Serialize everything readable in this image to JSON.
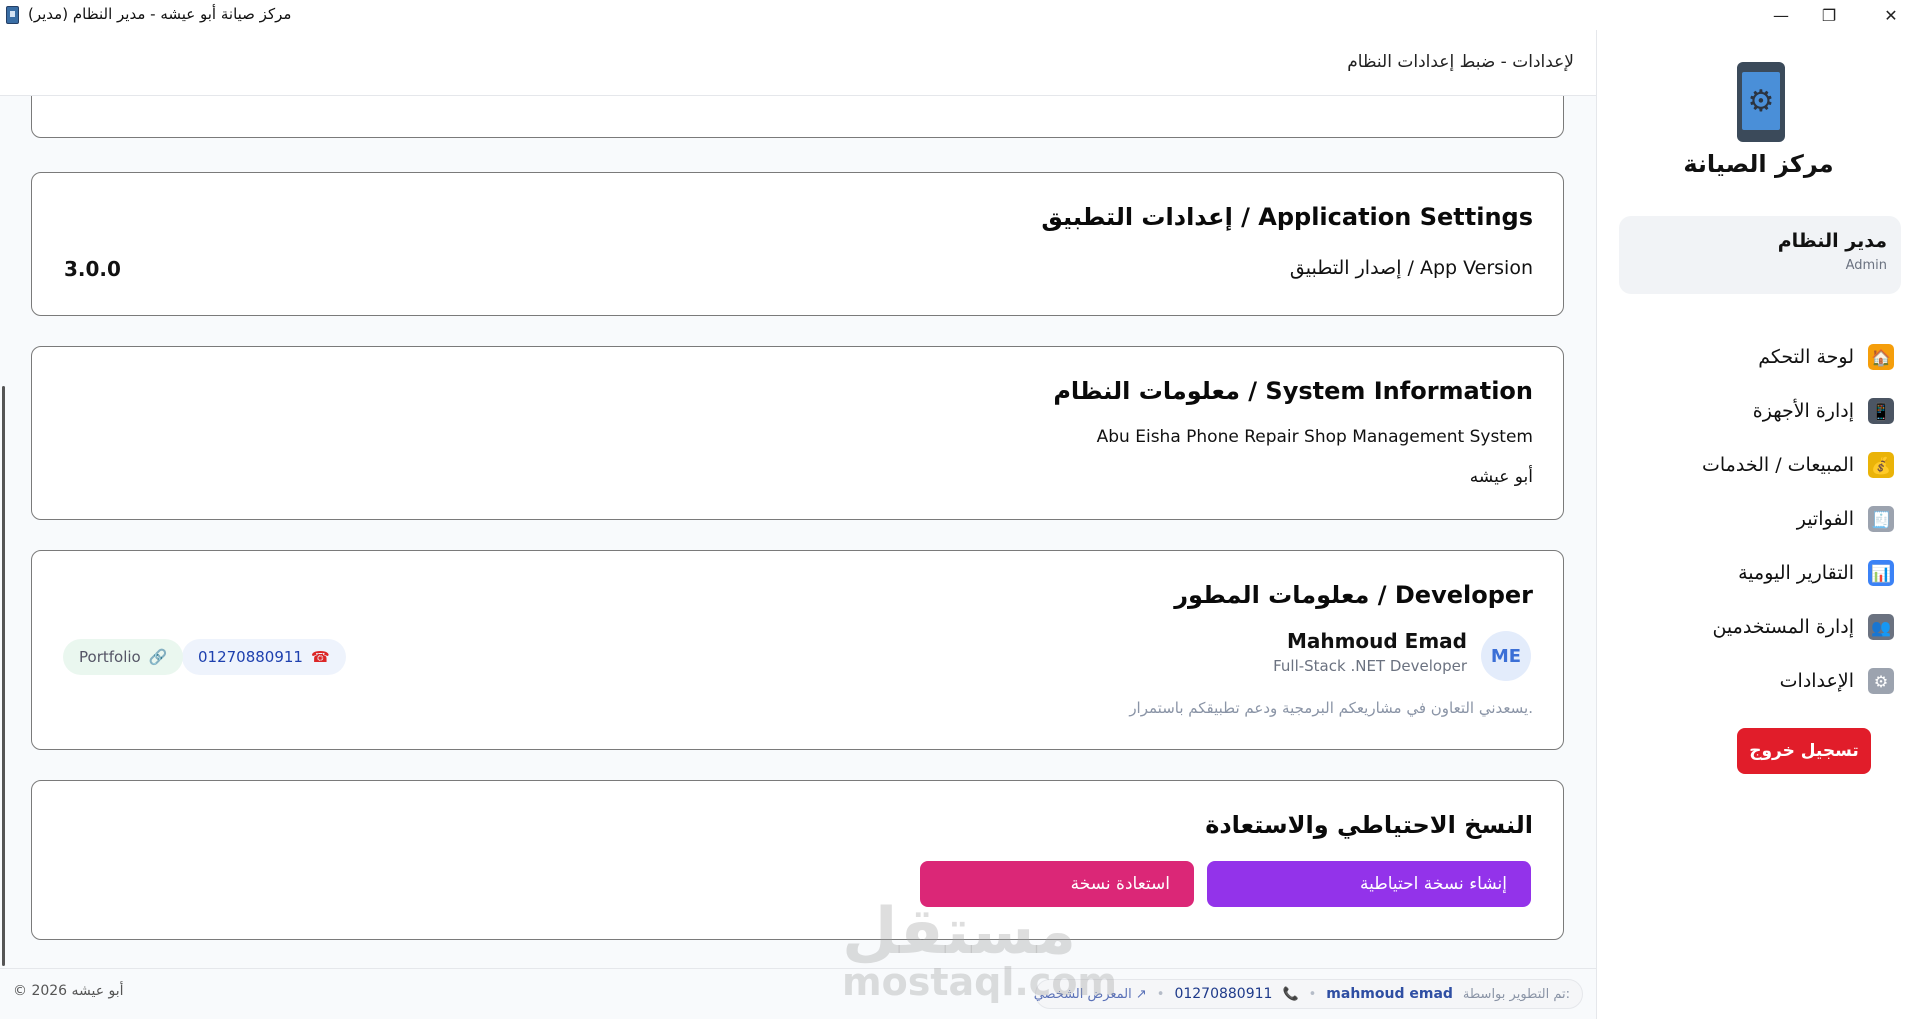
{
  "window": {
    "title": "مركز صيانة أبو عيشه - مدير النظام (مدير)",
    "minimize": "—",
    "maximize": "❐",
    "close": "✕"
  },
  "sidebar": {
    "brand": "مركز الصيانة",
    "user": {
      "name": "مدير النظام",
      "role": "Admin"
    },
    "items": [
      {
        "label": "لوحة التحكم",
        "icon": "home-icon",
        "glyph": "🏠",
        "color": "#f59e0b"
      },
      {
        "label": "إدارة الأجهزة",
        "icon": "device-icon",
        "glyph": "📱",
        "color": "#4b5563"
      },
      {
        "label": "المبيعات / الخدمات",
        "icon": "money-bag-icon",
        "glyph": "💰",
        "color": "#eab308"
      },
      {
        "label": "الفواتير",
        "icon": "invoice-icon",
        "glyph": "🧾",
        "color": "#9ca3af"
      },
      {
        "label": "التقارير اليومية",
        "icon": "chart-icon",
        "glyph": "📊",
        "color": "#3b82f6"
      },
      {
        "label": "إدارة المستخدمين",
        "icon": "users-icon",
        "glyph": "👥",
        "color": "#6b7280"
      },
      {
        "label": "الإعدادات",
        "icon": "gear-icon",
        "glyph": "⚙",
        "color": "#9ca3af"
      }
    ],
    "logout": "تسجيل خروج"
  },
  "header": {
    "title": "لإعدادات - ضبط إعدادات النظام"
  },
  "app_settings": {
    "title": "إعدادات التطبيق / Application Settings",
    "version_label": "إصدار التطبيق / App Version",
    "version_value": "3.0.0"
  },
  "system_info": {
    "title": "معلومات النظام / System Information",
    "line1": "Abu Eisha Phone Repair Shop Management System",
    "line2": "أبو عيشه"
  },
  "developer": {
    "title": "معلومات المطور / Developer",
    "initials": "ME",
    "name": "Mahmoud Emad",
    "role": "Full-Stack .NET Developer",
    "phone": "01270880911",
    "portfolio": "Portfolio",
    "note": "يسعدني التعاون في مشاريعكم البرمجية ودعم تطبيقكم باستمرار."
  },
  "backup": {
    "title": "النسخ الاحتياطي والاستعادة",
    "create": "إنشاء نسخة احتياطية",
    "restore": "استعادة نسخة"
  },
  "footer": {
    "copyright": "© 2026 أبو عيشه",
    "dev_label": "تم التطوير بواسطة:",
    "dev_name": "mahmoud emad",
    "dev_phone": "01270880911",
    "portfolio": "المعرض الشخصي ↗"
  },
  "watermark": {
    "line1": "مستقل",
    "line2": "mostaql.com"
  }
}
